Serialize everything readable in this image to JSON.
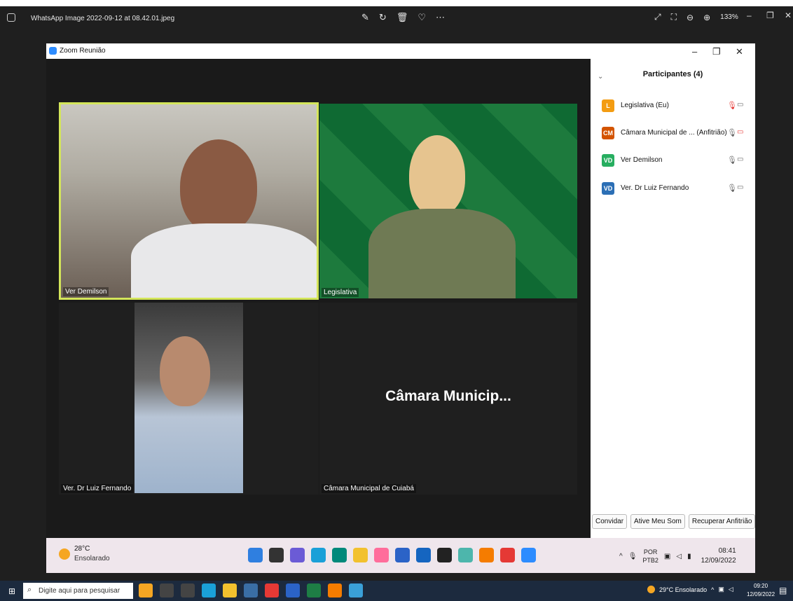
{
  "viewer": {
    "file_name": "WhatsApp Image 2022-09-12 at 08.42.01.jpeg",
    "zoom_level": "133%"
  },
  "zoom_window": {
    "title": "Zoom Reunião"
  },
  "participants_panel": {
    "title": "Participantes (4)",
    "participants": [
      {
        "initials": "L",
        "name": "Legislativa (Eu)",
        "color": "#f39c12",
        "mic": "muted",
        "camera": "on"
      },
      {
        "initials": "CM",
        "name": "Câmara Municipal de ... (Anfitrião)",
        "color": "#d35400",
        "mic": "on",
        "camera": "off"
      },
      {
        "initials": "VD",
        "name": "Ver Demilson",
        "color": "#27ae60",
        "mic": "on",
        "camera": "on"
      },
      {
        "initials": "VD",
        "name": "Ver. Dr Luiz Fernando",
        "color": "#2c6fb5",
        "mic": "on",
        "camera": "on"
      }
    ],
    "buttons": {
      "invite": "Convidar",
      "unmute": "Ative Meu Som",
      "reclaim_host": "Recuperar Anfitrião"
    }
  },
  "tiles": [
    {
      "label": "Ver Demilson",
      "active_speaker": true
    },
    {
      "label": "Legislativa"
    },
    {
      "label": "Ver. Dr Luiz Fernando"
    },
    {
      "label": "Câmara Municipal de Cuiabá",
      "big_name": "Câmara  Municip..."
    }
  ],
  "inner_taskbar": {
    "temperature": "28°C",
    "condition": "Ensolarado",
    "lang_line1": "POR",
    "lang_line2": "PTB2",
    "time": "08:41",
    "date": "12/09/2022"
  },
  "outer_taskbar": {
    "search_placeholder": "Digite aqui para pesquisar",
    "weather": "29°C  Ensolarado",
    "time": "09:20",
    "date": "12/09/2022"
  }
}
